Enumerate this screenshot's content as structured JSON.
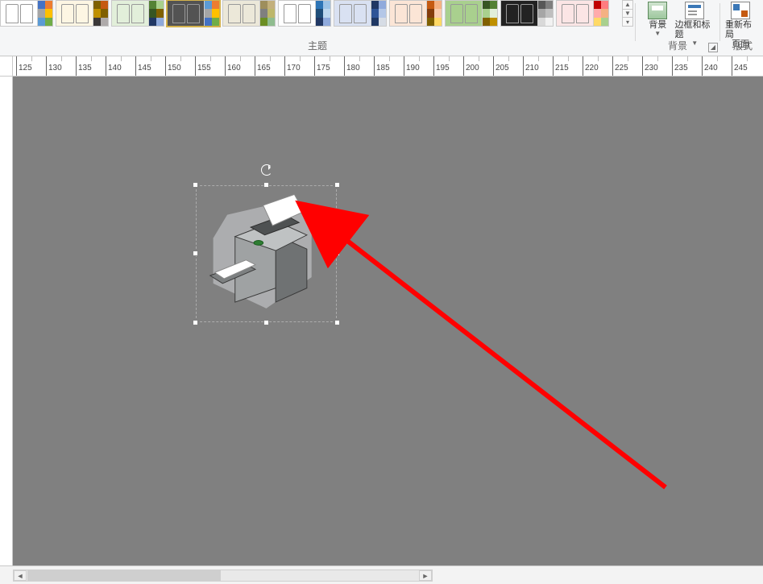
{
  "ribbon": {
    "themes_label": "主题",
    "background_group_label": "背景",
    "format_group_label": "版式",
    "buttons": {
      "background": "背景",
      "border_title": "边框和标题",
      "relayout_line1": "重新布局",
      "relayout_line2": "页面"
    }
  },
  "ruler": {
    "start": 125,
    "step": 5,
    "count": 25
  },
  "canvas": {
    "selected_object": "printer-clipart"
  }
}
